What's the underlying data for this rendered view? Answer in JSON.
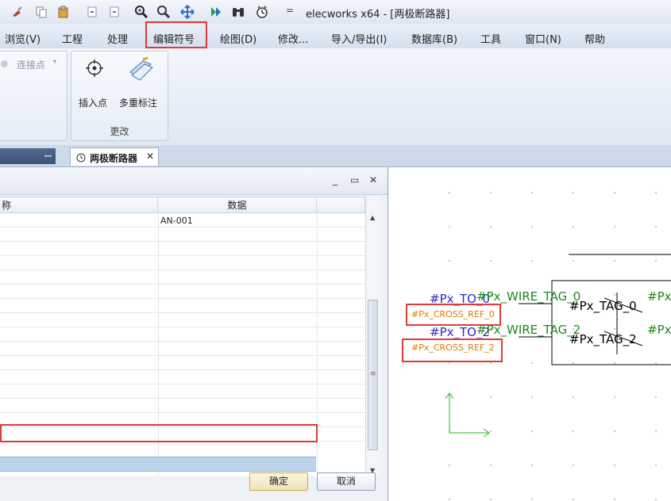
{
  "window": {
    "title": "elecworks x64 - [两极断路器]"
  },
  "quick_access": {
    "icons": [
      "delete-icon",
      "copy-icon",
      "paste-icon",
      "undo-icon",
      "redo-icon",
      "zoom-fit-icon",
      "zoom-icon",
      "pan-icon",
      "play-icon",
      "binoculars-icon",
      "clock-icon"
    ],
    "separator": "="
  },
  "menu": {
    "items": [
      "浏览(V)",
      "工程",
      "处理",
      "编辑符号",
      "绘图(D)",
      "修改...",
      "导入/导出(I)",
      "数据库(B)",
      "工具",
      "窗口(N)",
      "帮助"
    ],
    "highlighted": "编辑符号"
  },
  "ribbon": {
    "partial_label": "连接点",
    "group_change": {
      "label": "更改",
      "buttons": [
        {
          "label": "插入点",
          "icon": "crosshair-icon"
        },
        {
          "label": "多重标注",
          "icon": "multi-tag-icon"
        }
      ]
    }
  },
  "tabs": {
    "document_tab": "两极断路器",
    "pin_glyph": "ꟷ",
    "close_glyph": "✕"
  },
  "dialog": {
    "window_buttons": [
      "_",
      "▭",
      "✕"
    ],
    "columns": [
      "称",
      "数据"
    ],
    "rows": [
      {
        "name": "",
        "data": "AN-001"
      },
      {
        "name": "",
        "data": ""
      },
      {
        "name": "",
        "data": ""
      },
      {
        "name": "",
        "data": ""
      },
      {
        "name": "",
        "data": ""
      },
      {
        "name": "",
        "data": ""
      },
      {
        "name": "",
        "data": ""
      },
      {
        "name": "",
        "data": ""
      },
      {
        "name": "",
        "data": ""
      },
      {
        "name": "",
        "data": ""
      },
      {
        "name": "",
        "data": ""
      },
      {
        "name": "",
        "data": ""
      },
      {
        "name": "",
        "data": ""
      },
      {
        "name": "",
        "data": ""
      },
      {
        "name": "",
        "data": ""
      },
      {
        "name": "",
        "data": ""
      }
    ],
    "ok_button": "确定",
    "cancel_button": "取消"
  },
  "canvas": {
    "labels": {
      "to_0": "#Px_TO_0",
      "wire_tag_0": "#Px_WIRE_TAG_0",
      "cross_ref_0": "#Px_CROSS_REF_0",
      "to_2": "#Px_TO_2",
      "wire_tag_2": "#Px_WIRE_TAG_2",
      "cross_ref_2": "#Px_CROSS_REF_2",
      "tag_0": "#Px_TAG_0",
      "tag_2": "#Px_TAG_2",
      "px_right_1": "#Px",
      "px_right_2": "#Px"
    },
    "colors": {
      "to": "#2a2ad0",
      "wire": "#1a8a1a",
      "cross_ref": "#e07a00",
      "axis": "#22bb22",
      "highlight": "#e03a3a"
    }
  }
}
